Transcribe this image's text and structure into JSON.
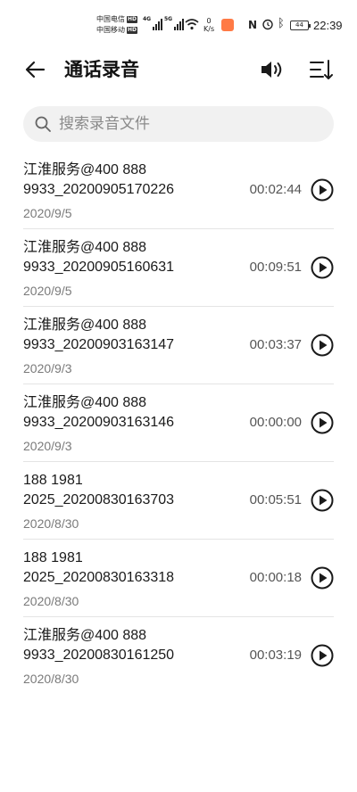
{
  "status_bar": {
    "carrier_1": "中国电信",
    "carrier_2": "中国移动",
    "hd_1": "HD",
    "hd_2": "HD",
    "network_1": "4G",
    "network_2": "5G",
    "speed_value": "0",
    "speed_unit": "K/s",
    "nfc": "N",
    "battery": "44",
    "time": "22:39"
  },
  "header": {
    "title": "通话录音",
    "back_icon": "arrow-left-icon",
    "speaker_icon": "speaker-icon",
    "sort_icon": "sort-icon"
  },
  "search": {
    "placeholder": "搜索录音文件",
    "icon": "search-icon"
  },
  "recordings": [
    {
      "name": "江淮服务@400 888\n9933_20200905170226",
      "date": "2020/9/5",
      "duration": "00:02:44"
    },
    {
      "name": "江淮服务@400 888\n9933_20200905160631",
      "date": "2020/9/5",
      "duration": "00:09:51"
    },
    {
      "name": "江淮服务@400 888\n9933_20200903163147",
      "date": "2020/9/3",
      "duration": "00:03:37"
    },
    {
      "name": "江淮服务@400 888\n9933_20200903163146",
      "date": "2020/9/3",
      "duration": "00:00:00"
    },
    {
      "name": "188 1981\n2025_20200830163703",
      "date": "2020/8/30",
      "duration": "00:05:51"
    },
    {
      "name": "188 1981\n2025_20200830163318",
      "date": "2020/8/30",
      "duration": "00:00:18"
    },
    {
      "name": "江淮服务@400 888\n9933_20200830161250",
      "date": "2020/8/30",
      "duration": "00:03:19"
    }
  ],
  "colors": {
    "text_primary": "#1a1a1a",
    "text_secondary": "#7a7a7a",
    "search_bg": "#f1f1f1",
    "divider": "#e4e4e4"
  }
}
